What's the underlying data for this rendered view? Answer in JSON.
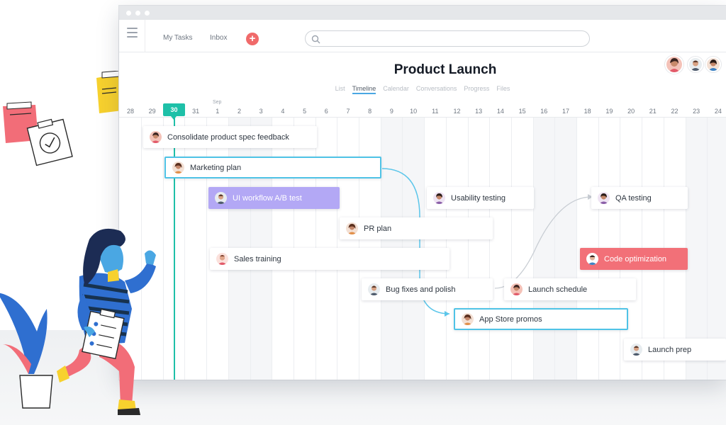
{
  "nav": {
    "my_tasks": "My Tasks",
    "inbox": "Inbox",
    "add_icon": "plus-icon",
    "search_placeholder": ""
  },
  "project": {
    "title": "Product Launch"
  },
  "tabs": [
    "List",
    "Timeline",
    "Calendar",
    "Conversations",
    "Progress",
    "Files"
  ],
  "active_tab": "Timeline",
  "timeline": {
    "month_label": "Sep",
    "today": "30",
    "dates": [
      "28",
      "29",
      "30",
      "31",
      "1",
      "2",
      "3",
      "4",
      "5",
      "6",
      "7",
      "8",
      "9",
      "10",
      "11",
      "12",
      "13",
      "14",
      "15",
      "16",
      "17",
      "18",
      "19",
      "20",
      "21",
      "22",
      "23",
      "24"
    ]
  },
  "tasks": [
    {
      "name": "Consolidate product spec feedback",
      "style": "normal"
    },
    {
      "name": "Marketing plan",
      "style": "selected"
    },
    {
      "name": "UI workflow A/B test",
      "style": "purple"
    },
    {
      "name": "Usability testing",
      "style": "normal"
    },
    {
      "name": "QA testing",
      "style": "normal"
    },
    {
      "name": "PR plan",
      "style": "normal"
    },
    {
      "name": "Sales training",
      "style": "normal"
    },
    {
      "name": "Code optimization",
      "style": "red"
    },
    {
      "name": "Bug fixes and polish",
      "style": "normal"
    },
    {
      "name": "Launch schedule",
      "style": "normal"
    },
    {
      "name": "App Store promos",
      "style": "selected"
    },
    {
      "name": "Launch prep",
      "style": "normal"
    }
  ],
  "colors": {
    "accent": "#1ec0a8",
    "dependency": "#5cc6ea",
    "purple": "#b3a8f5",
    "red": "#f27078",
    "add": "#f06a6a"
  }
}
